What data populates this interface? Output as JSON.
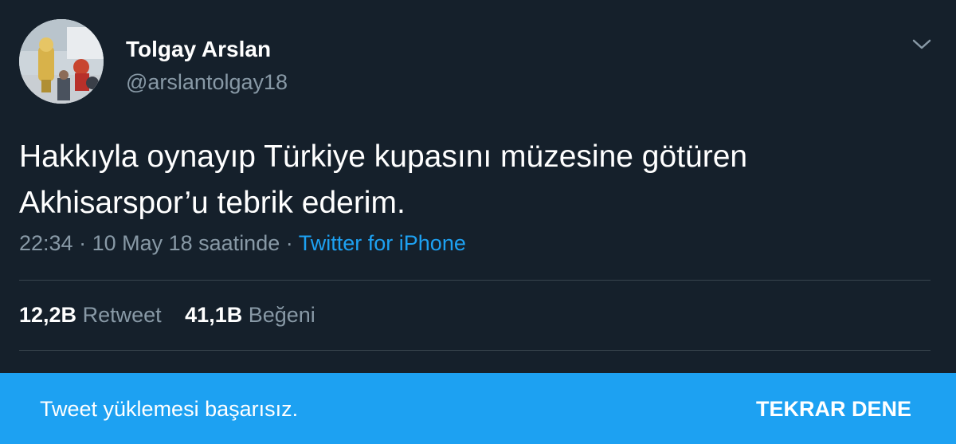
{
  "colors": {
    "background": "#15202b",
    "text_primary": "#ffffff",
    "text_secondary": "#8899a6",
    "link": "#1da1f2",
    "divider": "#38444d",
    "snackbar": "#1da1f2"
  },
  "author": {
    "name": "Tolgay Arslan",
    "handle": "@arslantolgay18",
    "avatar_icon": "profile-photo-trophy"
  },
  "tweet": {
    "text": "Hakkıyla oynayıp Türkiye kupasını müzesine götüren Akhisarspor’u tebrik ederim.",
    "time": "22:34",
    "separator": " · ",
    "date": "10 May 18 saatinde",
    "source": "Twitter for iPhone"
  },
  "menu_icon": "chevron-down-icon",
  "stats": {
    "retweets_count": "12,2B",
    "retweets_label": "Retweet",
    "likes_count": "41,1B",
    "likes_label": "Beğeni"
  },
  "snackbar": {
    "message": "Tweet yüklemesi başarısız.",
    "action": "TEKRAR DENE"
  }
}
